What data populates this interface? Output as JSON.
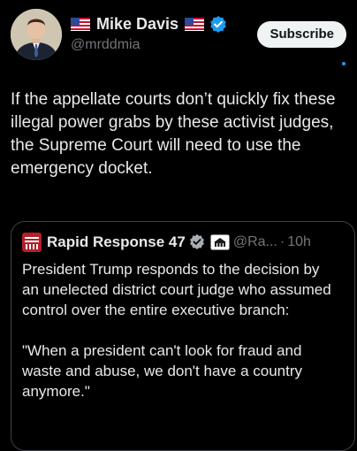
{
  "author": {
    "display_name": "Mike Davis",
    "handle": "@mrddmia",
    "flag_icon": "us-flag-icon",
    "verified_icon": "verified-badge-icon"
  },
  "subscribe_label": "Subscribe",
  "post_text": "If the appellate courts don’t quickly fix these illegal power grabs by these activist judges, the Supreme Court will need to use the emergency docket.",
  "quoted_post": {
    "display_name": "Rapid Response 47",
    "handle": "@Ra...",
    "separator": "·",
    "time": "10h",
    "affiliate_badge": "white-house-badge-icon",
    "paragraphs": [
      "President Trump responds to the decision by an unelected district court judge who assumed control over the entire executive branch:",
      "\"When a president can't look for fraud and waste and abuse, we don't have a country anymore.\""
    ]
  },
  "colors": {
    "background": "#000000",
    "text": "#e7e9ea",
    "secondary_text": "#71767b",
    "verified_blue": "#1d9bf0",
    "border": "#3d4247"
  }
}
